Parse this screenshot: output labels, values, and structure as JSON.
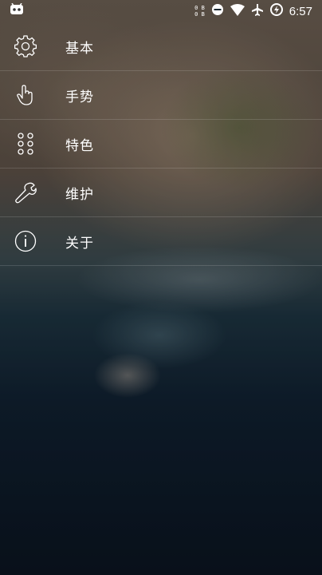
{
  "status_bar": {
    "net_up": "0 B",
    "net_down": "0 B",
    "time": "6:57",
    "icons": [
      "android-icon",
      "network-speed",
      "do-not-disturb-icon",
      "wifi-icon",
      "airplane-icon",
      "battery-charging-icon"
    ]
  },
  "menu": {
    "items": [
      {
        "label": "基本",
        "icon": "gear-icon"
      },
      {
        "label": "手势",
        "icon": "hand-pointer-icon"
      },
      {
        "label": "特色",
        "icon": "dots-grid-icon"
      },
      {
        "label": "维护",
        "icon": "wrench-icon"
      },
      {
        "label": "关于",
        "icon": "info-icon"
      }
    ]
  },
  "colors": {
    "text": "#ffffff",
    "divider": "rgba(255,255,255,0.14)"
  }
}
